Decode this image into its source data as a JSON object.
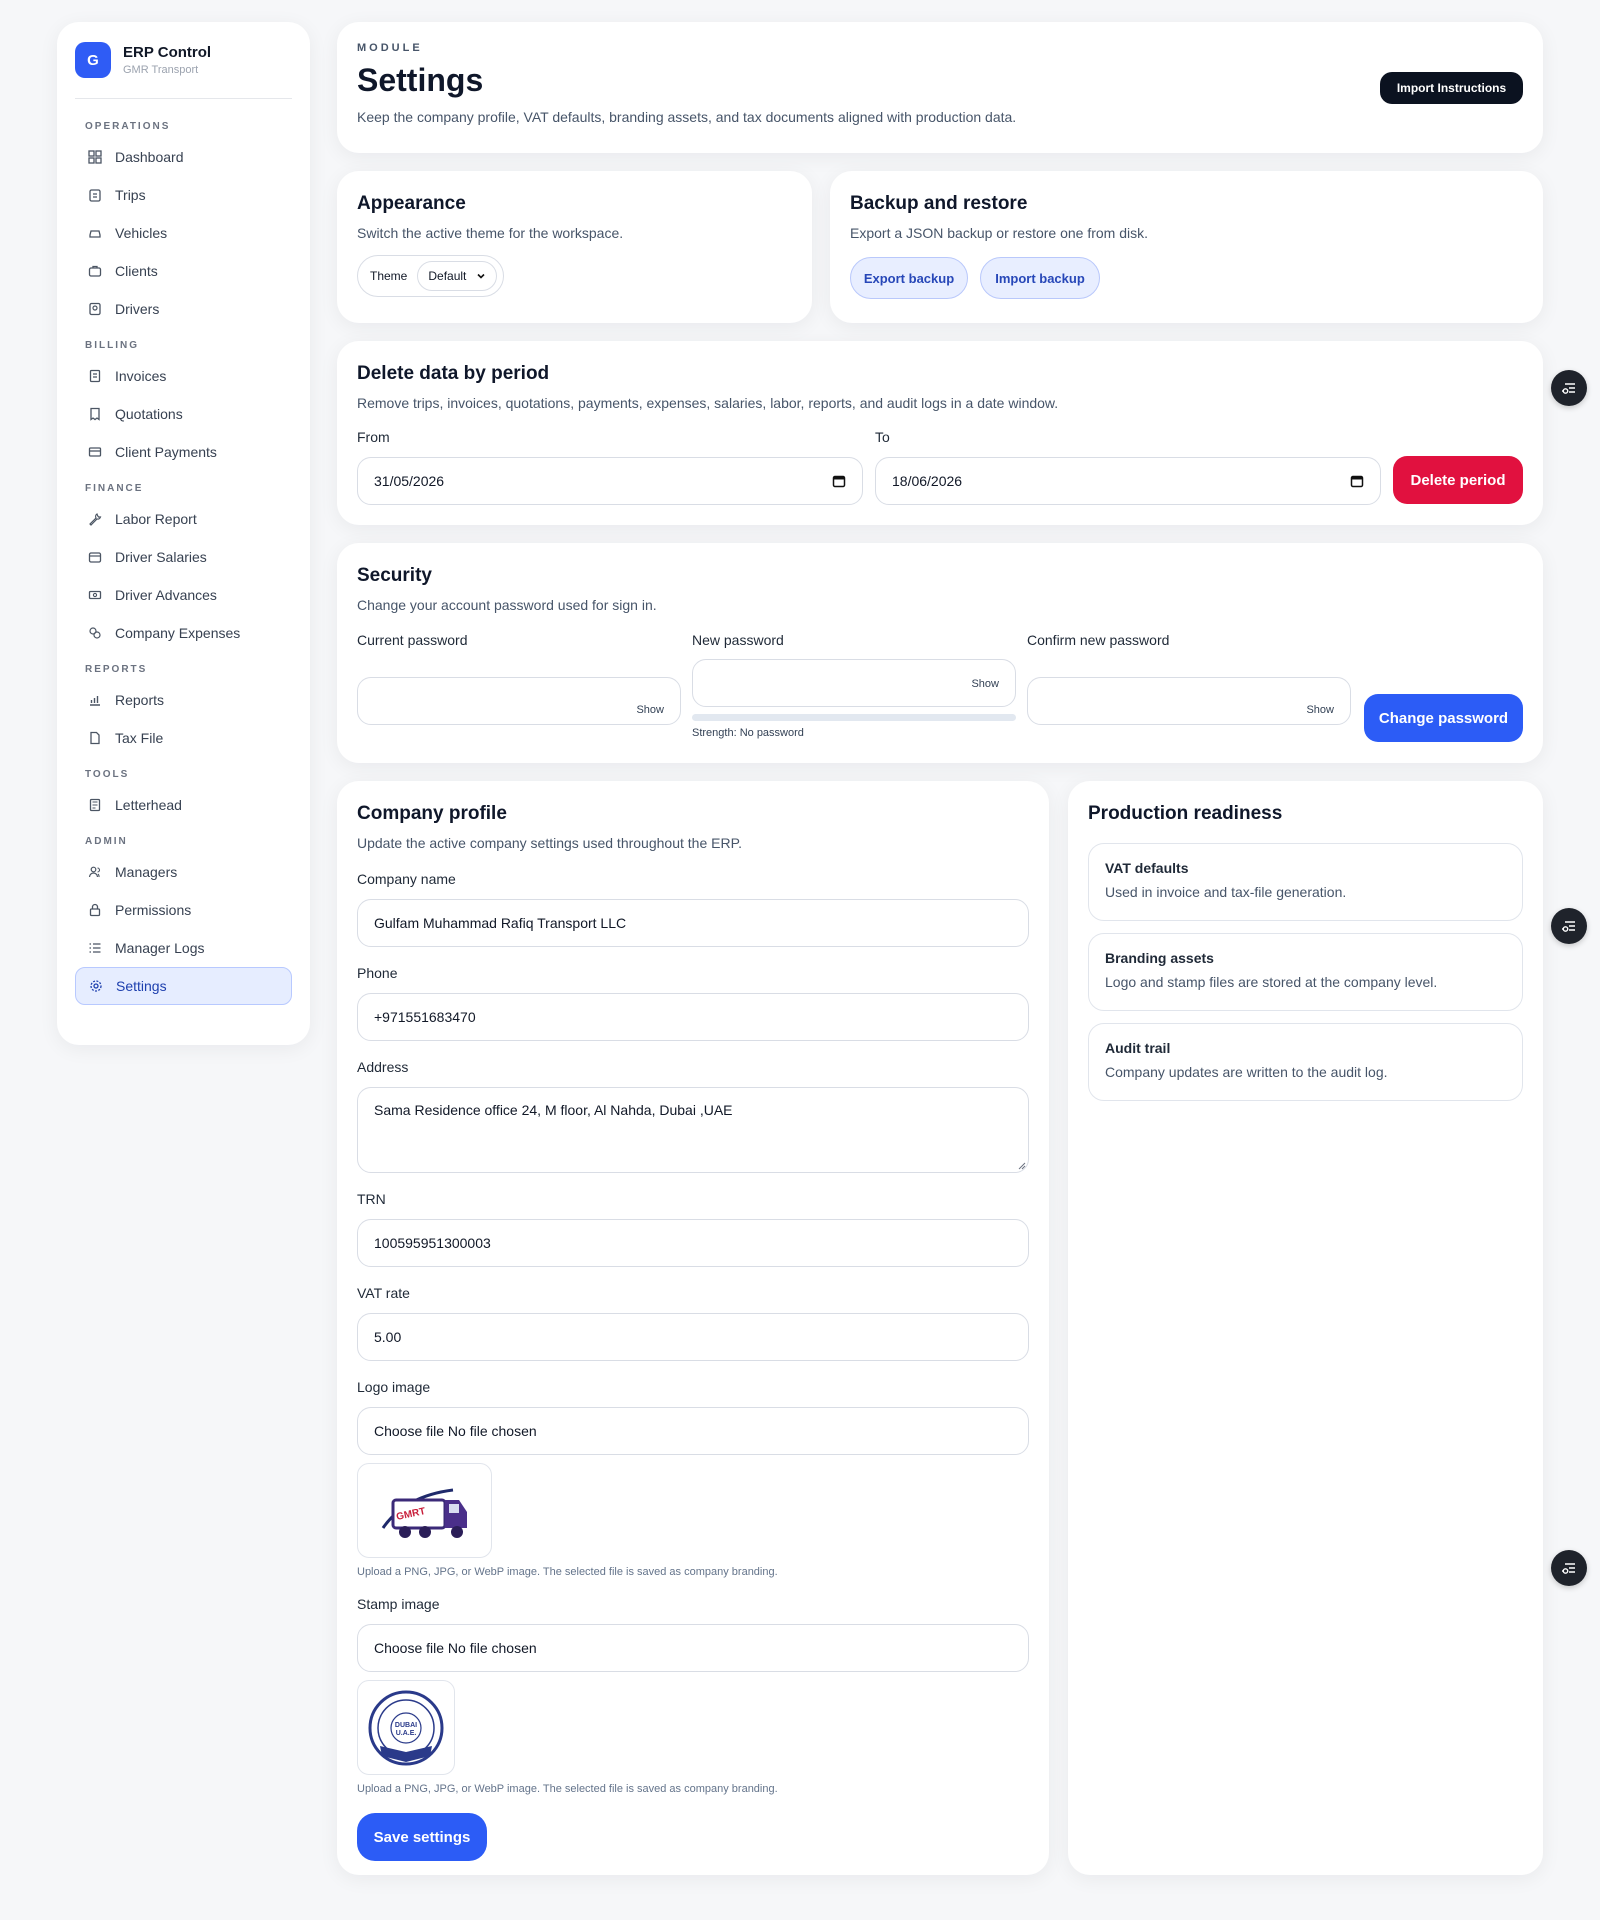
{
  "brand": {
    "logo_letter": "G",
    "title": "ERP Control",
    "subtitle": "GMR Transport"
  },
  "sidebar": {
    "sections": [
      {
        "title": "OPERATIONS",
        "items": [
          {
            "label": "Dashboard",
            "icon": "grid-icon"
          },
          {
            "label": "Trips",
            "icon": "clipboard-icon"
          },
          {
            "label": "Vehicles",
            "icon": "car-icon"
          },
          {
            "label": "Clients",
            "icon": "briefcase-icon"
          },
          {
            "label": "Drivers",
            "icon": "id-badge-icon"
          }
        ]
      },
      {
        "title": "BILLING",
        "items": [
          {
            "label": "Invoices",
            "icon": "document-icon"
          },
          {
            "label": "Quotations",
            "icon": "receipt-icon"
          },
          {
            "label": "Client Payments",
            "icon": "payment-icon"
          }
        ]
      },
      {
        "title": "FINANCE",
        "items": [
          {
            "label": "Labor Report",
            "icon": "wrench-icon"
          },
          {
            "label": "Driver Salaries",
            "icon": "wallet-icon"
          },
          {
            "label": "Driver Advances",
            "icon": "cash-icon"
          },
          {
            "label": "Company Expenses",
            "icon": "coins-icon"
          }
        ]
      },
      {
        "title": "REPORTS",
        "items": [
          {
            "label": "Reports",
            "icon": "chart-icon"
          },
          {
            "label": "Tax File",
            "icon": "file-icon"
          }
        ]
      },
      {
        "title": "TOOLS",
        "items": [
          {
            "label": "Letterhead",
            "icon": "letterhead-icon"
          }
        ]
      },
      {
        "title": "ADMIN",
        "items": [
          {
            "label": "Managers",
            "icon": "users-icon"
          },
          {
            "label": "Permissions",
            "icon": "lock-icon"
          },
          {
            "label": "Manager Logs",
            "icon": "list-icon"
          },
          {
            "label": "Settings",
            "icon": "gear-icon",
            "active": true
          }
        ]
      }
    ]
  },
  "header": {
    "eyebrow": "MODULE",
    "title": "Settings",
    "description": "Keep the company profile, VAT defaults, branding assets, and tax documents aligned with production data.",
    "import_button": "Import Instructions"
  },
  "appearance": {
    "title": "Appearance",
    "description": "Switch the active theme for the workspace.",
    "theme_label": "Theme",
    "theme_value": "Default"
  },
  "backup": {
    "title": "Backup and restore",
    "description": "Export a JSON backup or restore one from disk.",
    "export_label": "Export backup",
    "import_label": "Import backup"
  },
  "delete_period": {
    "title": "Delete data by period",
    "description": "Remove trips, invoices, quotations, payments, expenses, salaries, labor, reports, and audit logs in a date window.",
    "from_label": "From",
    "from_value": "31/05/2026",
    "to_label": "To",
    "to_value": "18/06/2026",
    "button": "Delete period"
  },
  "security": {
    "title": "Security",
    "description": "Change your account password used for sign in.",
    "current_label": "Current password",
    "new_label": "New password",
    "confirm_label": "Confirm new password",
    "show_label": "Show",
    "strength": "Strength: No password",
    "strength_level": 0,
    "button": "Change password"
  },
  "company": {
    "title": "Company profile",
    "description": "Update the active company settings used throughout the ERP.",
    "name_label": "Company name",
    "name_value": "Gulfam Muhammad Rafiq Transport LLC",
    "phone_label": "Phone",
    "phone_value": "+971551683470",
    "address_label": "Address",
    "address_value": "Sama Residence office 24, M floor, Al Nahda, Dubai ,UAE",
    "trn_label": "TRN",
    "trn_value": "100595951300003",
    "vat_label": "VAT rate",
    "vat_value": "5.00",
    "logo_label": "Logo image",
    "logo_file": "Choose file No file chosen",
    "logo_text": "GMRT",
    "logo_hint": "Upload a PNG, JPG, or WebP image. The selected file is saved as company branding.",
    "stamp_label": "Stamp image",
    "stamp_file": "Choose file No file chosen",
    "stamp_text_1": "DUBAI",
    "stamp_text_2": "U.A.E.",
    "stamp_hint": "Upload a PNG, JPG, or WebP image. The selected file is saved as company branding.",
    "save_button": "Save settings"
  },
  "readiness": {
    "title": "Production readiness",
    "items": [
      {
        "title": "VAT defaults",
        "desc": "Used in invoice and tax-file generation."
      },
      {
        "title": "Branding assets",
        "desc": "Logo and stamp files are stored at the company level."
      },
      {
        "title": "Audit trail",
        "desc": "Company updates are written to the audit log."
      }
    ]
  },
  "colors": {
    "accent": "#2c5cf6",
    "danger": "#e1113f",
    "dark": "#0b1220",
    "background": "#f6f7f9"
  }
}
